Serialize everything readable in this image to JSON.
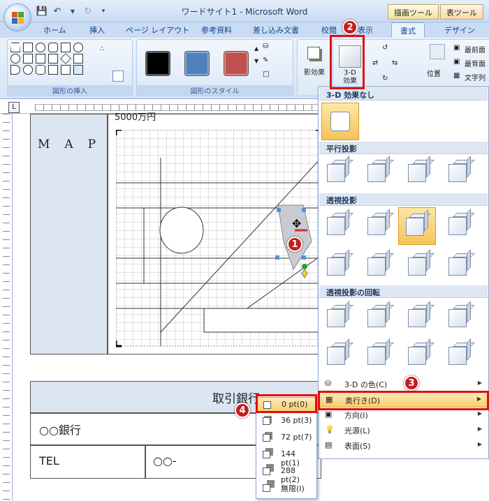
{
  "window": {
    "title": "ワードサイト1 - Microsoft Word",
    "context_tools": [
      "描画ツール",
      "表ツール"
    ]
  },
  "tabs": [
    {
      "label": "ホーム"
    },
    {
      "label": "挿入"
    },
    {
      "label": "ページ レイアウト"
    },
    {
      "label": "参考資料"
    },
    {
      "label": "差し込み文書"
    },
    {
      "label": "校閲"
    },
    {
      "label": "表示"
    },
    {
      "label": "書式"
    },
    {
      "label": "デザイン"
    }
  ],
  "ribbon": {
    "shapes_group_label": "図形の挿入",
    "styles_group_label": "図形のスタイル",
    "shadow_label": "影効果",
    "threed_label": "3-D\n効果",
    "threed_line1": "3-D",
    "threed_line2": "効果",
    "position_label": "位置",
    "bring_front": "最前面",
    "send_back": "最背面",
    "text_wrap": "文字列",
    "style_colors": [
      "#000000",
      "#4f81bd",
      "#c0504d"
    ]
  },
  "gallery": {
    "sections": [
      {
        "header": "3-D 効果なし"
      },
      {
        "header": "平行投影"
      },
      {
        "header": "透視投影"
      },
      {
        "header": "透視投影の回転"
      }
    ],
    "menu": [
      {
        "label": "3-D の色(C)"
      },
      {
        "label": "奥行き(D)"
      },
      {
        "label": "方向(I)"
      },
      {
        "label": "光源(L)"
      },
      {
        "label": "表面(S)"
      }
    ]
  },
  "depth_submenu": {
    "items": [
      {
        "label": "0 pt(0)"
      },
      {
        "label": "36 pt(3)"
      },
      {
        "label": "72 pt(7)"
      },
      {
        "label": "144 pt(1)"
      },
      {
        "label": "288 pt(2)"
      },
      {
        "label": "無限(I)"
      }
    ]
  },
  "document": {
    "map_label": "M　A　P",
    "top_cut_text": "5000万円",
    "bank_header": "取引銀行",
    "bank_name": "○○銀行",
    "tel_label": "TEL",
    "tel_value": "○○-"
  },
  "callouts": [
    "1",
    "2",
    "3",
    "4"
  ],
  "colors": {
    "accent_red": "#e01010",
    "highlight": "#f8cf6f",
    "map_cell_bg": "#dce6f2"
  }
}
